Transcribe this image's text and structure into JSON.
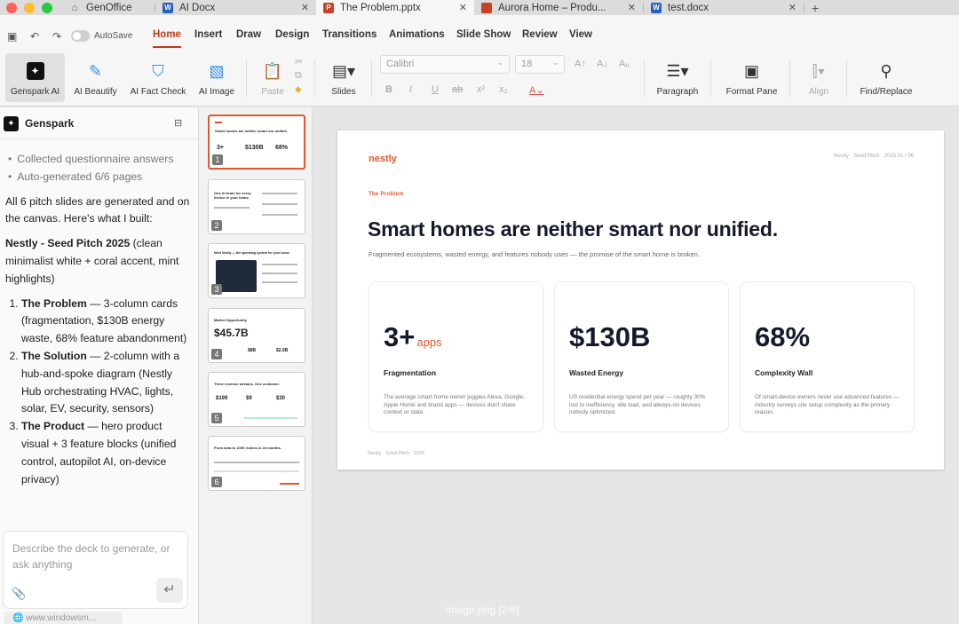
{
  "tabs": [
    {
      "label": "GenOffice",
      "icon": "home-icon"
    },
    {
      "label": "AI Docx",
      "icon": "word-doc-icon"
    },
    {
      "label": "The Problem.pptx",
      "icon": "powerpoint-icon"
    },
    {
      "label": "Aurora Home – Produ...",
      "icon": "powerpoint-icon"
    },
    {
      "label": "test.docx",
      "icon": "word-doc-icon"
    }
  ],
  "quick_access": {
    "autosave_label": "AutoSave"
  },
  "menu": [
    "Home",
    "Insert",
    "Draw",
    "Design",
    "Transitions",
    "Animations",
    "Slide Show",
    "Review",
    "View"
  ],
  "ribbon": {
    "genspark_ai": "Genspark AI",
    "ai_beautify": "AI Beautify",
    "ai_fact_check": "AI Fact Check",
    "ai_image": "AI Image",
    "paste": "Paste",
    "slides": "Slides",
    "font_name": "Calibri",
    "font_size": "18",
    "paragraph": "Paragraph",
    "format_pane": "Format Pane",
    "align": "Align",
    "find_replace": "Find/Replace"
  },
  "panel": {
    "title": "Genspark",
    "bullets": [
      "Collected questionnaire answers",
      "Auto-generated 6/6 pages"
    ],
    "intro": "All 6 pitch slides are generated and on the canvas. Here's what I built:",
    "deck_name": "Nestly - Seed Pitch 2025",
    "deck_desc": " (clean minimalist white + coral accent, mint highlights)",
    "items": [
      {
        "head": "The Problem",
        "desc": " — 3-column cards (fragmentation, $130B energy waste, 68% feature abandonment)"
      },
      {
        "head": "The Solution",
        "desc": " — 2-column with a hub-and-spoke diagram (Nestly Hub orchestrating HVAC, lights, solar, EV, security, sensors)"
      },
      {
        "head": "The Product",
        "desc": " — hero product visual + 3 feature blocks (unified control, autopilot AI, on-device privacy)"
      }
    ],
    "input_placeholder": "Describe the deck to generate, or ask anything",
    "url_text": "www.windowsm..."
  },
  "thumbnails": [
    {
      "num": "1",
      "title": "Smart homes are neither smart nor unified.",
      "stats": [
        "3+",
        "$130B",
        "68%"
      ]
    },
    {
      "num": "2",
      "title": "One AI brain for every device in your home.",
      "stats": []
    },
    {
      "num": "3",
      "title": "Meet Nestly — the operating system for your home.",
      "stats": []
    },
    {
      "num": "4",
      "title": "Market Opportunity",
      "stats": [
        "$45.7B",
        "$8B",
        "$2.6B"
      ]
    },
    {
      "num": "5",
      "title": "Three revenue streams. One customer.",
      "stats": [
        "$199",
        "$9",
        "$30"
      ]
    },
    {
      "num": "6",
      "title": "From beta to 100K homes in 24 months.",
      "stats": []
    }
  ],
  "slide": {
    "brand": "nestly",
    "meta": "Nestly · Seed Pitch · 2025 01 / 06",
    "kicker": "The Problem",
    "title": "Smart homes are neither smart nor unified.",
    "subtitle": "Fragmented ecosystems, wasted energy, and features nobody uses — the promise of the smart home is broken.",
    "cards": [
      {
        "stat": "3+",
        "suffix": "apps",
        "label": "Fragmentation",
        "desc": "The average smart-home owner juggles Alexa, Google, Apple Home and brand apps — devices don't share context or state."
      },
      {
        "stat": "$130B",
        "suffix": "",
        "label": "Wasted Energy",
        "desc": "US residential energy spend per year — roughly 30% lost to inefficiency, idle load, and always-on devices nobody optimized."
      },
      {
        "stat": "68%",
        "suffix": "",
        "label": "Complexity Wall",
        "desc": "Of smart-device owners never use advanced features — industry surveys cite setup complexity as the primary reason."
      }
    ],
    "footer": "Nestly · Seed Pitch · 2025"
  },
  "caption": "image.png [2/6]",
  "colors": {
    "accent": "#e2562d",
    "menu_active": "#c4391d"
  }
}
